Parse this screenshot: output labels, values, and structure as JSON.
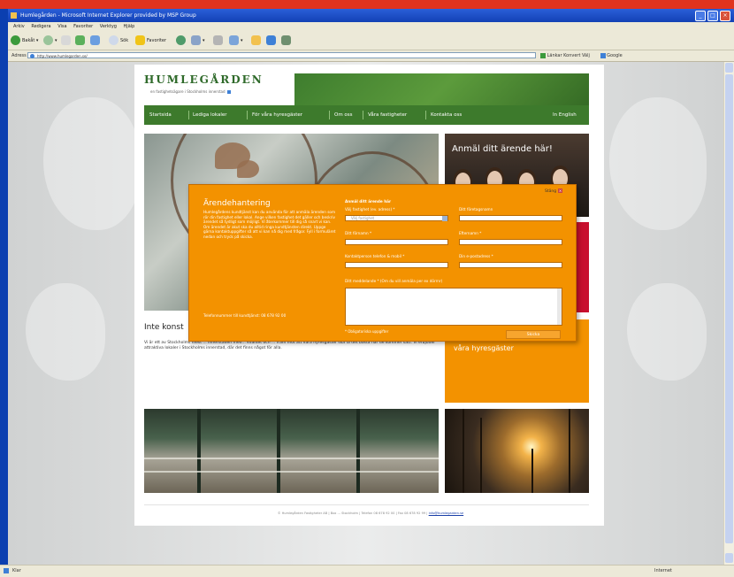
{
  "browser": {
    "title": "Humlegården - Microsoft Internet Explorer provided by MSP Group",
    "menu": [
      "Arkiv",
      "Redigera",
      "Visa",
      "Favoriter",
      "Verktyg",
      "Hjälp"
    ],
    "toolbar": {
      "back": "Bakåt",
      "favorites": "Favoriter"
    },
    "address": "http://www.humlegarden.se/",
    "address_label": "Adress",
    "right_tools": "Länkar  Konvert  Välj",
    "google": "Google",
    "status": "Klar"
  },
  "site": {
    "logo": "HUMLEGÅRDEN",
    "tagline": "en fastighetsägare i Stockholms innerstad",
    "nav": [
      "Startsida",
      "Lediga lokaler",
      "För våra hyresgäster",
      "Om oss",
      "Våra fastigheter",
      "Kontakta oss"
    ],
    "lang": "In English",
    "hero_caption": "Anmäl ditt ärende här!",
    "side_text": "våra hyresgäster",
    "content_title": "Inte konst",
    "content_text": "Vi är ett av Stockholms mest ... innerstaden med... kvalitet och ... fram mot att våra hyresgäster ska få det bästa när de kommer sätt. Vi erbjuder attraktiva lokaler i Stockholms innerstad, där det finns något för alla.",
    "footer_text": "© Humlegården Fastigheter AB | Box ...  Stockholm | Telefon 08 678 92 00 | Fax 08 678 92 99 |",
    "footer_link": "info@humlegarden.se"
  },
  "dialog": {
    "close_label": "Stäng",
    "title": "Ärendehantering",
    "body": "Humlegårdens kundtjänst kan du använda för att anmäla ärenden som rör din fastighet eller lokal. Ange vilken fastighet det gäller och beskriv ärendet så tydligt som möjligt. Vi återkommer till dig så snart vi kan. Om ärendet är akut ska du alltid ringa kundtjänsten direkt. Uppge gärna kontaktuppgifter så att vi kan nå dig med frågor. Fyll i formuläret nedan och tryck på skicka.",
    "phone": "Telefonnummer till kundtjänst: 08 678 92 00",
    "form_head": "Anmäl ditt ärende här",
    "labels": {
      "property": "Välj fastighet (ev. adress) *",
      "company": "Ditt företagsnamn",
      "name": "Ditt förnamn *",
      "lastname": "Efternamn *",
      "phone": "Kontaktperson telefon & mobil *",
      "email": "Din e-postadress *",
      "message": "Ditt meddelande * (Om du vill anmäla per ex dörrnr)"
    },
    "select_value": "Välj fastighet",
    "note": "* Obligatoriska uppgifter",
    "submit": "Skicka"
  }
}
